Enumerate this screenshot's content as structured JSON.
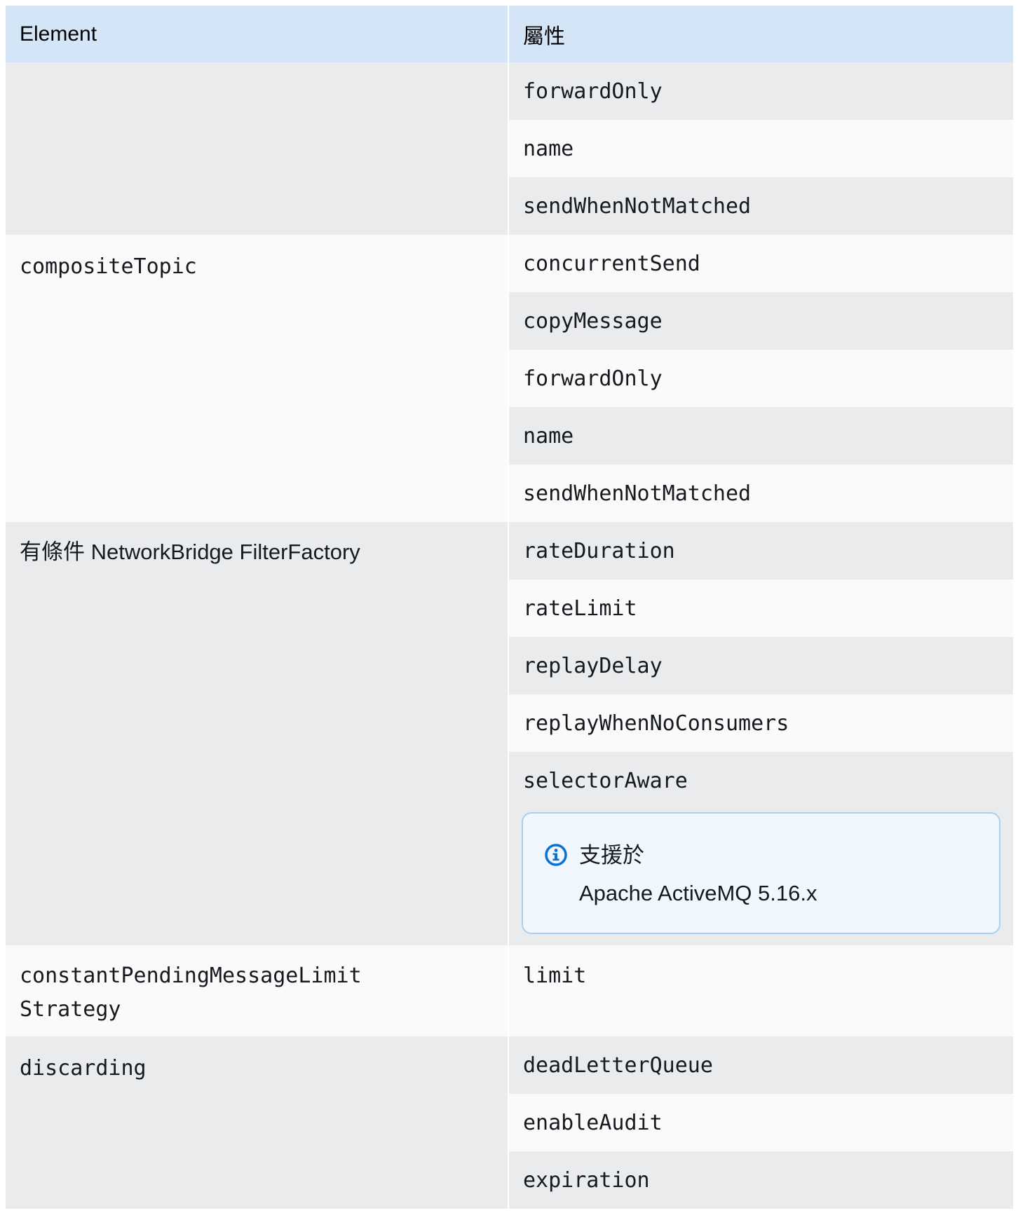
{
  "header": {
    "element_label": "Element",
    "attribute_label": "屬性"
  },
  "rows": [
    {
      "element": "",
      "attributes": [
        "forwardOnly",
        "name",
        "sendWhenNotMatched"
      ]
    },
    {
      "element": "compositeTopic",
      "attributes": [
        "concurrentSend",
        "copyMessage",
        "forwardOnly",
        "name",
        "sendWhenNotMatched"
      ]
    },
    {
      "element": "有條件 NetworkBridge FilterFactory",
      "attributes": [
        "rateDuration",
        "rateLimit",
        "replayDelay",
        "replayWhenNoConsumers",
        "selectorAware"
      ],
      "note": {
        "icon": "info-icon",
        "title": "支援於",
        "body": "Apache ActiveMQ 5.16.x"
      }
    },
    {
      "element_line1": "constantPendingMessageLimit",
      "element_line2": "Strategy",
      "attributes": [
        "limit"
      ]
    },
    {
      "element": "discarding",
      "attributes": [
        "deadLetterQueue",
        "enableAudit",
        "expiration"
      ]
    }
  ],
  "colors": {
    "header_bg": "#d3e5f7",
    "row_gray": "#e9ebed",
    "row_light": "#fafafa",
    "note_bg": "#f0f7ff",
    "note_border": "#a9d0f0",
    "info_icon": "#0972d3"
  }
}
